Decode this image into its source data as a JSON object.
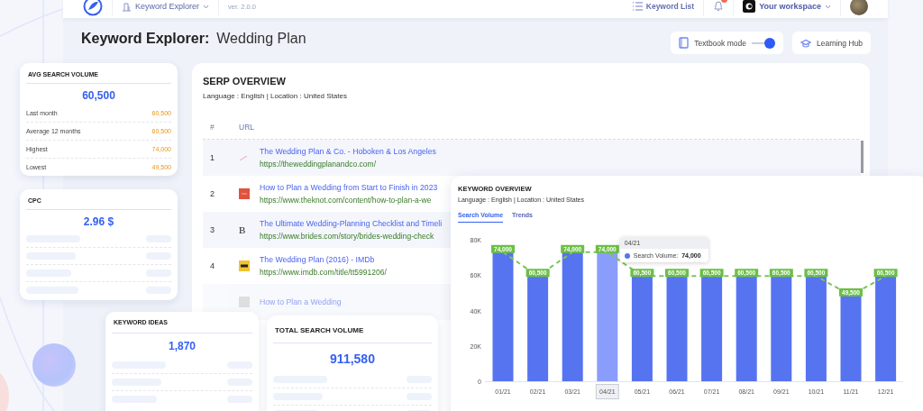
{
  "nav": {
    "app_menu": "Keyword Explorer",
    "version": "ver. 2.0.0",
    "keyword_list": "Keyword List",
    "notifications": {
      "unread": true
    },
    "workspace": "Your workspace"
  },
  "header": {
    "title": "Keyword Explorer:",
    "keyword": "Wedding Plan",
    "textbook_mode": {
      "label": "Textbook mode",
      "on": true
    },
    "learning_hub": "Learning Hub"
  },
  "serp_overview": {
    "title": "SERP OVERVIEW",
    "subtitle": "Language : English | Location : United States",
    "columns": [
      "#",
      "URL"
    ],
    "rows": [
      {
        "number": "1",
        "title": "The Wedding Plan & Co. - Hoboken & Los Angeles",
        "url": "https://theweddingplanandco.com/",
        "favicon": {
          "kind": "stroke"
        },
        "blurred": false
      },
      {
        "number": "2",
        "title": "How to Plan a Wedding from Start to Finish in 2023",
        "url": "https://www.theknot.com/content/how-to-plan-a-we",
        "favicon": {
          "kind": "red"
        },
        "blurred": false
      },
      {
        "number": "3",
        "title": "The Ultimate Wedding-Planning Checklist and Timeli",
        "url": "https://www.brides.com/story/brides-wedding-check",
        "favicon": {
          "kind": "letter",
          "text": "B"
        },
        "blurred": false
      },
      {
        "number": "4",
        "title": "The Wedding Plan (2016) - IMDb",
        "url": "https://www.imdb.com/title/tt5991206/",
        "favicon": {
          "kind": "yellow"
        },
        "blurred": false
      },
      {
        "title": "How to Plan a Wedding",
        "favicon": {
          "kind": "grey"
        },
        "blurred": true
      }
    ]
  },
  "metric_cards": [
    {
      "title": "AVG SEARCH VOLUME",
      "value": "60,500",
      "loading": false,
      "rows": [
        {
          "label": "Last month",
          "value": "60,500"
        },
        {
          "label": "Average 12 months",
          "value": "60,500"
        },
        {
          "label": "Highest",
          "value": "74,000"
        },
        {
          "label": "Lowest",
          "value": "49,500"
        }
      ]
    },
    {
      "title": "CPC",
      "value": "2.96 $",
      "loading": true
    },
    {
      "title": "KEYWORD IDEAS",
      "value": "1,870",
      "loading": true
    },
    {
      "title": "TOTAL SEARCH VOLUME",
      "value": "911,580",
      "loading": true
    }
  ],
  "keyword_overview": {
    "title": "KEYWORD OVERVIEW",
    "subtitle": "Language : English | Location : United States",
    "tabs": [
      {
        "label": "Search Volume",
        "selected": true
      },
      {
        "label": "Trends",
        "selected": false
      }
    ],
    "bar_states": [
      {
        "hovered": false
      },
      {
        "hovered": false
      },
      {
        "hovered": false
      },
      {
        "hovered": true
      },
      {
        "hovered": false
      },
      {
        "hovered": false
      },
      {
        "hovered": false
      },
      {
        "hovered": false
      },
      {
        "hovered": false
      },
      {
        "hovered": false
      },
      {
        "hovered": false
      },
      {
        "hovered": false
      }
    ],
    "tooltip": {
      "title": "04/21",
      "separator": ":",
      "value": "74,000"
    },
    "chart_data": {
      "type": "bar",
      "categories": [
        "01/21",
        "02/21",
        "03/21",
        "04/21",
        "05/21",
        "06/21",
        "07/21",
        "08/21",
        "09/21",
        "10/21",
        "11/21",
        "12/21"
      ],
      "series": [
        {
          "name": "Search Volume",
          "values": [
            74000,
            60500,
            74000,
            74000,
            60500,
            60500,
            60500,
            60500,
            60500,
            60500,
            49500,
            60500
          ]
        }
      ],
      "ylim": [
        0,
        80000
      ],
      "yticks": [
        {
          "value": 0,
          "label": "0"
        },
        {
          "value": 20000,
          "label": "20K"
        },
        {
          "value": 40000,
          "label": "40K"
        },
        {
          "value": 60000,
          "label": "60K"
        },
        {
          "value": 80000,
          "label": "80K"
        }
      ],
      "value_labels": [
        "74,000",
        "60,500",
        "74,000",
        "74,000",
        "60,500",
        "60,500",
        "60,500",
        "60,500",
        "60,500",
        "60,500",
        "49,500",
        "60,500"
      ]
    }
  }
}
